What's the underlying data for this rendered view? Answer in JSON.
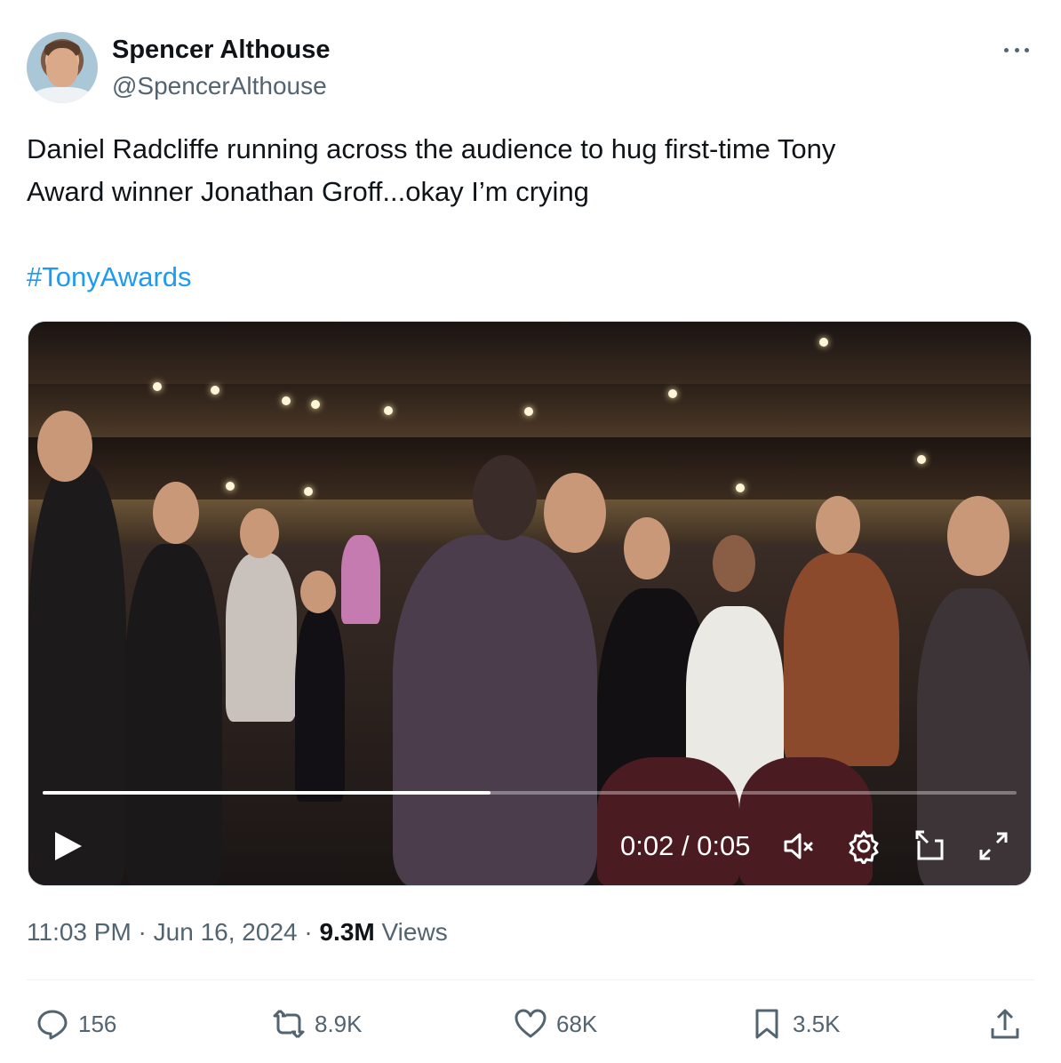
{
  "author": {
    "name": "Spencer Althouse",
    "handle": "@SpencerAlthouse"
  },
  "tweet": {
    "text_line1": "Daniel Radcliffe running across the audience to hug first-time Tony",
    "text_line2": "Award winner Jonathan Groff...okay I’m crying",
    "hashtag": "#TonyAwards"
  },
  "video": {
    "time_display": "0:02 / 0:05",
    "progress_fraction": 0.46,
    "icons": [
      "play-icon",
      "mute-icon",
      "settings-icon",
      "picture-in-picture-icon",
      "fullscreen-icon"
    ]
  },
  "meta": {
    "time": "11:03 PM",
    "separator1": " · ",
    "date": "Jun 16, 2024",
    "separator2": " · ",
    "views_count": "9.3M",
    "views_label": " Views"
  },
  "actions": {
    "replies": "156",
    "reposts": "8.9K",
    "likes": "68K",
    "bookmarks": "3.5K"
  },
  "colors": {
    "accent": "#1d9bf0",
    "secondary_text": "#536471",
    "primary_text": "#0f1419"
  }
}
